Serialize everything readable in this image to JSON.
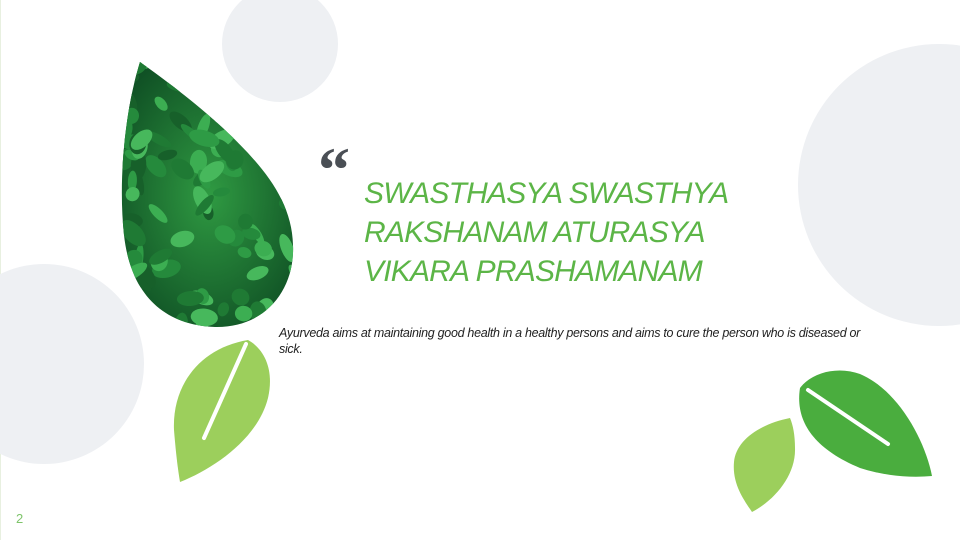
{
  "slide": {
    "quote_mark": "“",
    "quote_lines": [
      "SWASTHASYA SWASTHYA",
      "RAKSHANAM ATURASYA",
      "VIKARA PRASHAMANAM"
    ],
    "description": "Ayurveda aims at maintaining good health in a healthy persons and aims to cure the person who is diseased or sick.",
    "page_number": "2"
  },
  "colors": {
    "accent_green": "#5cb547",
    "light_green": "#9ccf5c",
    "dark_green": "#4aad3e",
    "quote_mark": "#4a4f55",
    "circle_gray": "#eef0f3"
  },
  "icons": [
    "leaf-photo-icon",
    "leaf-icon"
  ]
}
